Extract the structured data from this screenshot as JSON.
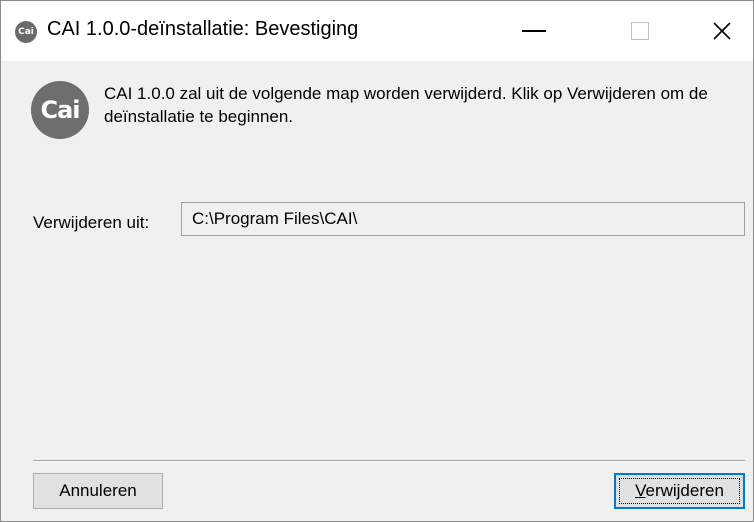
{
  "window": {
    "app_icon_text": "Cai",
    "title": "CAI 1.0.0-deïnstallatie: Bevestiging",
    "icons": {
      "minimize": "minimize-icon",
      "maximize": "maximize-icon",
      "close": "close-icon",
      "close_glyph": "✕"
    }
  },
  "content": {
    "logo_text": "Cai",
    "message": "CAI 1.0.0 zal uit de volgende map worden verwijderd. Klik op Verwijderen om de deïnstallatie te beginnen.",
    "field_label": "Verwijderen uit:",
    "path_value": "C:\\Program Files\\CAI\\"
  },
  "buttons": {
    "cancel_label": "Annuleren",
    "remove_label_first": "V",
    "remove_label_rest": "erwijderen"
  },
  "colors": {
    "focus_border": "#0078d7",
    "background": "#f0f0f0",
    "icon_gray": "#6e6e6e"
  }
}
